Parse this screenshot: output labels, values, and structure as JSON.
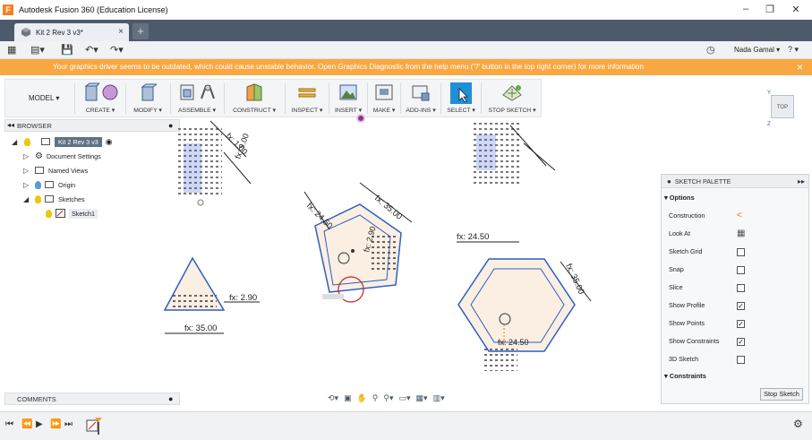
{
  "window": {
    "title": "Autodesk Fusion 360 (Education License)",
    "logo_letter": "F"
  },
  "tab": {
    "label": "Kit 2 Rev 3 v3*",
    "close": "×",
    "add": "+"
  },
  "quickbar": {
    "user": "Nada Gamal ▾",
    "help": "? ▾"
  },
  "warning": {
    "text": "Your graphics driver seems to be outdated, which could cause unstable behavior. Open Graphics Diagnostic from the help menu ('?' button in the top right corner) for more information",
    "close": "×"
  },
  "toolbar": {
    "model": "MODEL ▾",
    "groups": [
      "CREATE ▾",
      "MODIFY ▾",
      "ASSEMBLE ▾",
      "CONSTRUCT ▾",
      "INSPECT ▾",
      "INSERT ▾",
      "MAKE ▾",
      "ADD-INS ▾",
      "SELECT ▾",
      "STOP SKETCH ▾"
    ]
  },
  "viewcube": {
    "face": "TOP"
  },
  "browser": {
    "title": "BROWSER",
    "items": [
      {
        "label": "Kit 2 Rev 3 v3"
      },
      {
        "label": "Document Settings"
      },
      {
        "label": "Named Views"
      },
      {
        "label": "Origin"
      },
      {
        "label": "Sketches"
      },
      {
        "label": "Sketch1"
      }
    ]
  },
  "comments": {
    "title": "COMMENTS"
  },
  "palette": {
    "title": "SKETCH PALETTE",
    "options_header": "▾ Options",
    "constraints_header": "▾ Constraints",
    "rows": [
      {
        "label": "Construction"
      },
      {
        "label": "Look At"
      },
      {
        "label": "Sketch Grid"
      },
      {
        "label": "Snap"
      },
      {
        "label": "Slice"
      },
      {
        "label": "Show Profile"
      },
      {
        "label": "Show Points"
      },
      {
        "label": "Show Constraints"
      },
      {
        "label": "3D Sketch"
      }
    ],
    "checks": [
      "",
      "",
      "",
      "",
      "",
      "✓",
      "✓",
      "✓",
      ""
    ],
    "stop_button": "Stop Sketch"
  },
  "dimensions": {
    "d1": "fx: 24.50",
    "d2": "fx: 35.00",
    "d3": "fx: 24.50",
    "d4": "fx: 35.00",
    "d5": "fx: 2.90",
    "d6": "fx: 35.00",
    "d7": "fx: 2.90",
    "d8": "fx: 1.00",
    "d9": "fx: 9.00",
    "d10": "fx: 24.50"
  },
  "colors": {
    "warning": "#f8a843",
    "tabbar": "#4d5a6b",
    "sketch_line": "#2d5fbf",
    "profile_fill": "#fbefe3"
  }
}
